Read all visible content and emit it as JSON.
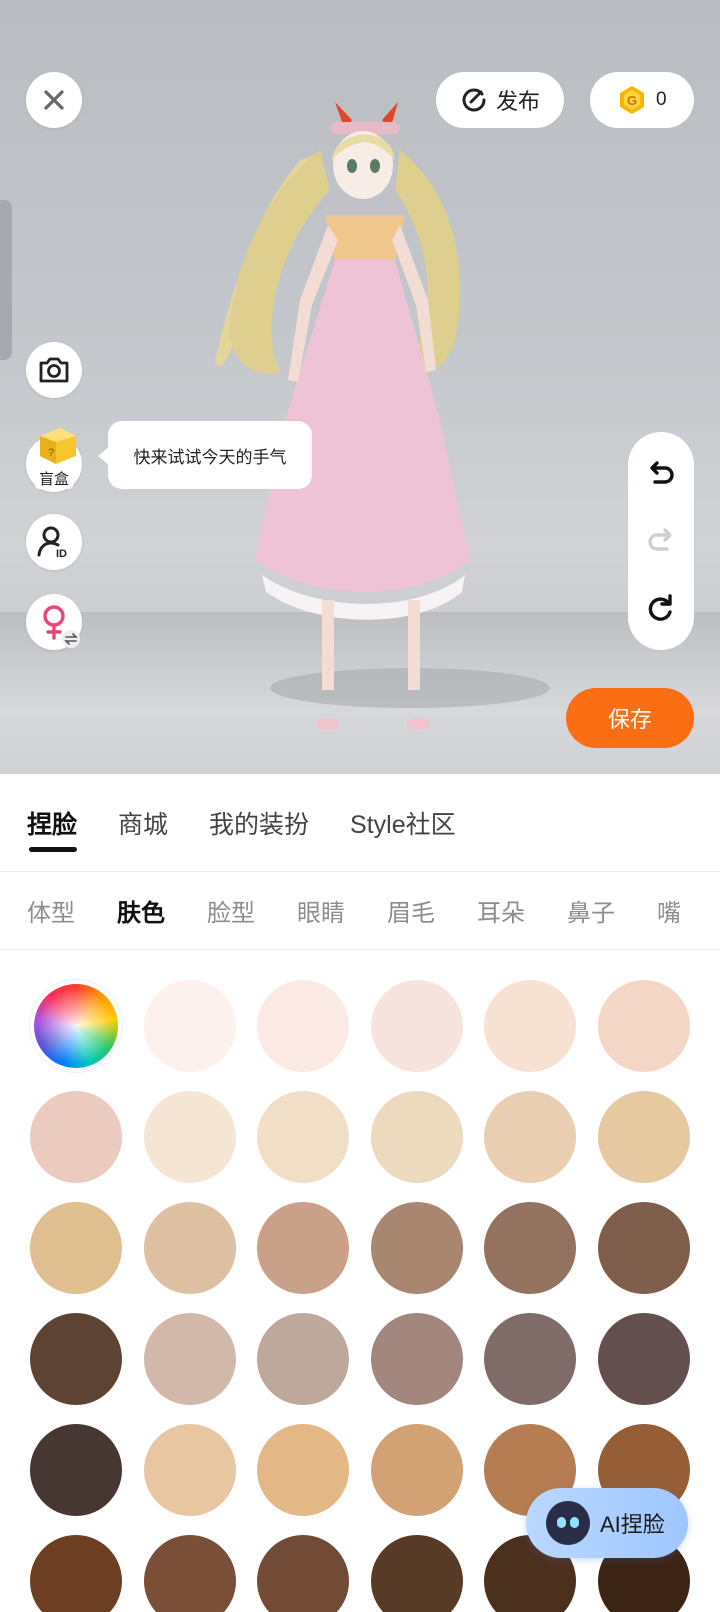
{
  "top_bar": {
    "publish_label": "发布",
    "coins": "0"
  },
  "side_tools": {
    "blind_box_label": "盲盒",
    "tooltip": "快来试试今天的手气"
  },
  "save_label": "保存",
  "main_tabs": [
    "捏脸",
    "商城",
    "我的装扮",
    "Style社区"
  ],
  "sub_tabs": [
    "体型",
    "肤色",
    "脸型",
    "眼睛",
    "眉毛",
    "耳朵",
    "鼻子",
    "嘴"
  ],
  "skin_colors": [
    "#fdf1ee",
    "#fbeae4",
    "#f6e3de",
    "#f7e1d2",
    "#f3d6c6",
    "#ebcbc0",
    "#f5e5d5",
    "#f0dfc6",
    "#edd9bd",
    "#eaceb2",
    "#e6c9a0",
    "#dfbe8f",
    "#ddc0a1",
    "#c9a088",
    "#a88670",
    "#93725f",
    "#7f5f4b",
    "#5d4333",
    "#d1b8aa",
    "#bea89c",
    "#a3877f",
    "#7f6b67",
    "#63504e",
    "#463733",
    "#e7c6a1",
    "#e4b886",
    "#d3a274",
    "#b57d51",
    "#965e36",
    "#6c3f22",
    "#7a4f37",
    "#714b35",
    "#583b27",
    "#4c301e",
    "#3b2414"
  ],
  "ai_button_label": "AI捏脸"
}
